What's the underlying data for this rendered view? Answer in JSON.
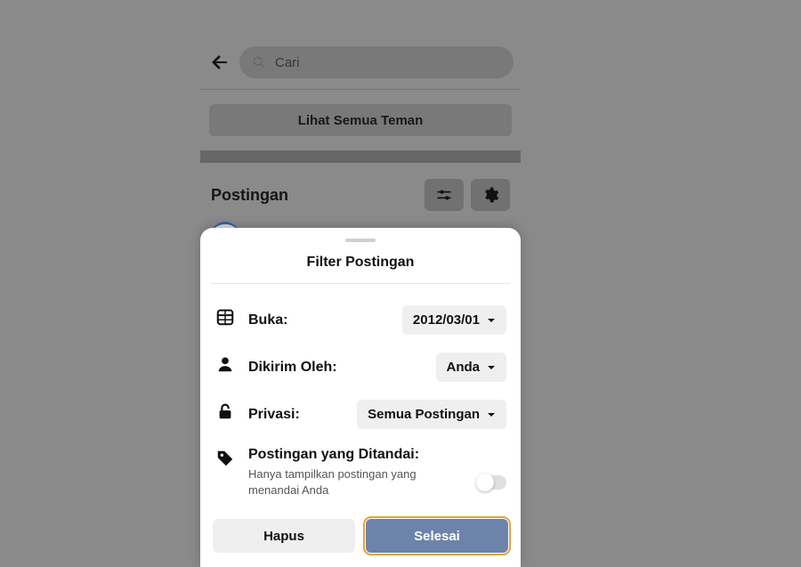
{
  "header": {
    "search_placeholder": "Cari"
  },
  "friends_button_label": "Lihat Semua Teman",
  "posts_section_title": "Postingan",
  "modal": {
    "title": "Filter Postingan",
    "rows": {
      "date": {
        "label": "Buka:",
        "value": "2012/03/01"
      },
      "author": {
        "label": "Dikirim Oleh:",
        "value": "Anda"
      },
      "privacy": {
        "label": "Privasi:",
        "value": "Semua Postingan"
      },
      "tagged": {
        "label": "Postingan yang Ditandai:",
        "sub": "Hanya tampilkan postingan yang menandai Anda",
        "enabled": false
      }
    },
    "actions": {
      "clear": "Hapus",
      "done": "Selesai"
    }
  }
}
